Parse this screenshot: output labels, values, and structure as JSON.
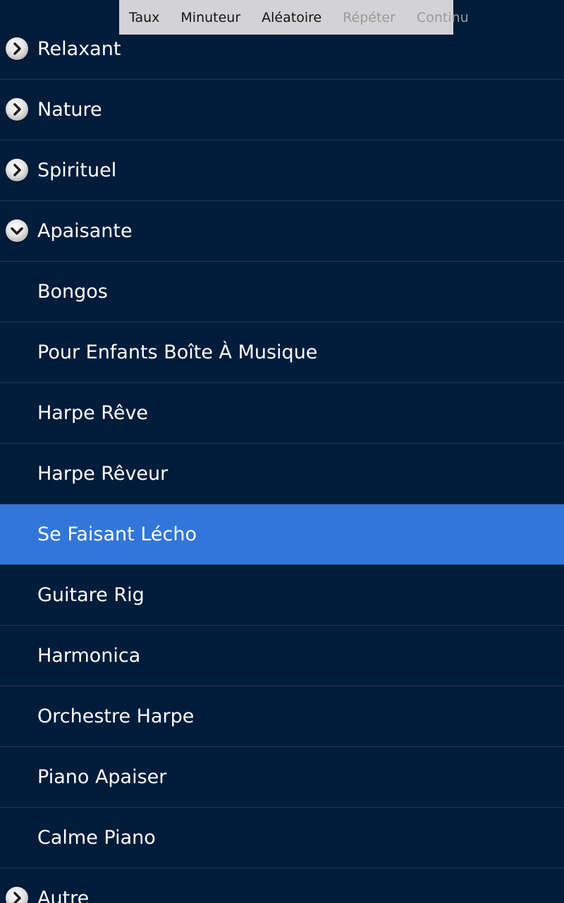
{
  "menu": {
    "items": [
      {
        "label": "Taux",
        "enabled": true
      },
      {
        "label": "Minuteur",
        "enabled": true
      },
      {
        "label": "Aléatoire",
        "enabled": true
      },
      {
        "label": "Répéter",
        "enabled": false
      },
      {
        "label": "Continu",
        "enabled": false
      }
    ]
  },
  "groups": {
    "relaxant": {
      "label": "Relaxant",
      "icon": "chevron-right-icon"
    },
    "nature": {
      "label": "Nature",
      "icon": "chevron-right-icon"
    },
    "spirituel": {
      "label": "Spirituel",
      "icon": "chevron-right-icon"
    },
    "apaisante": {
      "label": "Apaisante",
      "icon": "chevron-down-icon"
    },
    "autre": {
      "label": "Autre",
      "icon": "chevron-right-icon"
    }
  },
  "tracks": [
    {
      "label": "Bongos"
    },
    {
      "label": "Pour Enfants Boîte À Musique"
    },
    {
      "label": "Harpe Rêve"
    },
    {
      "label": "Harpe Rêveur"
    },
    {
      "label": "Se Faisant Lécho",
      "selected": true
    },
    {
      "label": "Guitare Rig"
    },
    {
      "label": "Harmonica"
    },
    {
      "label": "Orchestre Harpe"
    },
    {
      "label": "Piano Apaiser"
    },
    {
      "label": "Calme Piano"
    }
  ],
  "colors": {
    "background": "#001c3b",
    "selected_row": "#3276d9",
    "divider": "#24374f",
    "menu_background": "#d3d2d5"
  }
}
